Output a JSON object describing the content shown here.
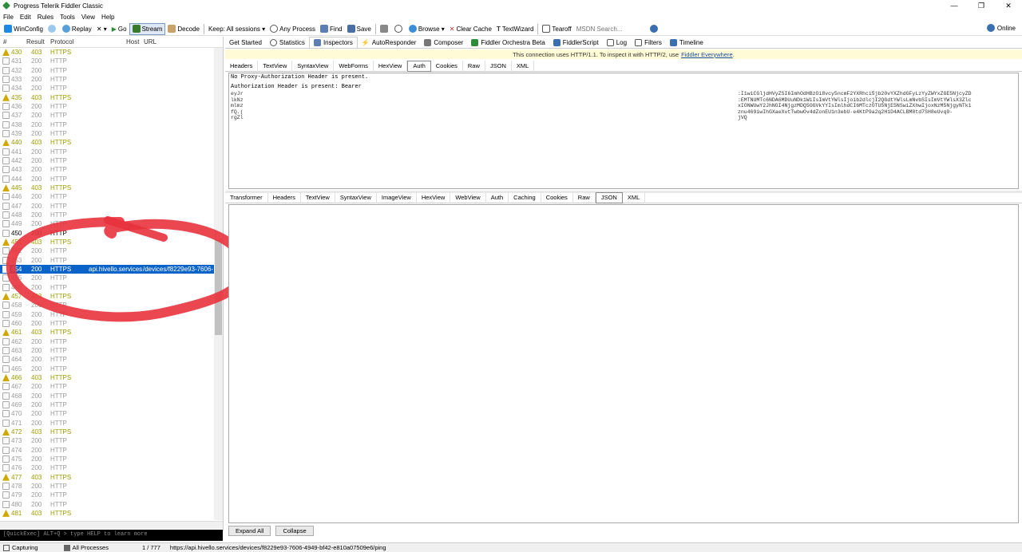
{
  "window": {
    "title": "Progress Telerik Fiddler Classic",
    "minimize": "—",
    "restore": "❐",
    "close": "✕"
  },
  "menu": [
    "File",
    "Edit",
    "Rules",
    "Tools",
    "View",
    "Help"
  ],
  "toolbar": {
    "winconfig": "WinConfig",
    "replay": "Replay",
    "remove": "✕ ▾",
    "go": "Go",
    "stream": "Stream",
    "decode": "Decode",
    "keep": "Keep: All sessions ▾",
    "any_process": "Any Process",
    "find": "Find",
    "save": "Save",
    "browse": "Browse ▾",
    "clear_cache": "Clear Cache",
    "textwizard": "TextWizard",
    "tearoff": "Tearoff",
    "search_placeholder": "MSDN Search...",
    "online": "Online"
  },
  "sessions": {
    "headers": {
      "num": "#",
      "result": "Result",
      "protocol": "Protocol",
      "host": "Host",
      "url": "URL"
    },
    "rows": [
      {
        "n": "430",
        "r": "403",
        "p": "HTTPS",
        "h": "",
        "u": "",
        "s": "olive",
        "i": "warn"
      },
      {
        "n": "431",
        "r": "200",
        "p": "HTTP",
        "h": "",
        "u": "",
        "s": "gray",
        "i": "doc"
      },
      {
        "n": "432",
        "r": "200",
        "p": "HTTP",
        "h": "",
        "u": "",
        "s": "gray",
        "i": "doc"
      },
      {
        "n": "433",
        "r": "200",
        "p": "HTTP",
        "h": "",
        "u": "",
        "s": "gray",
        "i": "doc"
      },
      {
        "n": "434",
        "r": "200",
        "p": "HTTP",
        "h": "",
        "u": "",
        "s": "gray",
        "i": "doc"
      },
      {
        "n": "435",
        "r": "403",
        "p": "HTTPS",
        "h": "",
        "u": "",
        "s": "olive",
        "i": "warn"
      },
      {
        "n": "436",
        "r": "200",
        "p": "HTTP",
        "h": "",
        "u": "",
        "s": "gray",
        "i": "doc"
      },
      {
        "n": "437",
        "r": "200",
        "p": "HTTP",
        "h": "",
        "u": "",
        "s": "gray",
        "i": "doc"
      },
      {
        "n": "438",
        "r": "200",
        "p": "HTTP",
        "h": "",
        "u": "",
        "s": "gray",
        "i": "doc"
      },
      {
        "n": "439",
        "r": "200",
        "p": "HTTP",
        "h": "",
        "u": "",
        "s": "gray",
        "i": "doc"
      },
      {
        "n": "440",
        "r": "403",
        "p": "HTTPS",
        "h": "",
        "u": "",
        "s": "olive",
        "i": "warn"
      },
      {
        "n": "441",
        "r": "200",
        "p": "HTTP",
        "h": "",
        "u": "",
        "s": "gray",
        "i": "doc"
      },
      {
        "n": "442",
        "r": "200",
        "p": "HTTP",
        "h": "",
        "u": "",
        "s": "gray",
        "i": "doc"
      },
      {
        "n": "443",
        "r": "200",
        "p": "HTTP",
        "h": "",
        "u": "",
        "s": "gray",
        "i": "doc"
      },
      {
        "n": "444",
        "r": "200",
        "p": "HTTP",
        "h": "",
        "u": "",
        "s": "gray",
        "i": "doc"
      },
      {
        "n": "445",
        "r": "403",
        "p": "HTTPS",
        "h": "",
        "u": "",
        "s": "olive",
        "i": "warn"
      },
      {
        "n": "446",
        "r": "200",
        "p": "HTTP",
        "h": "",
        "u": "",
        "s": "gray",
        "i": "doc"
      },
      {
        "n": "447",
        "r": "200",
        "p": "HTTP",
        "h": "",
        "u": "",
        "s": "gray",
        "i": "doc"
      },
      {
        "n": "448",
        "r": "200",
        "p": "HTTP",
        "h": "",
        "u": "",
        "s": "gray",
        "i": "doc"
      },
      {
        "n": "449",
        "r": "200",
        "p": "HTTP",
        "h": "",
        "u": "",
        "s": "gray",
        "i": "doc"
      },
      {
        "n": "450",
        "r": "200",
        "p": "HTTP",
        "h": "",
        "u": "",
        "s": "black",
        "i": "doc"
      },
      {
        "n": "451",
        "r": "403",
        "p": "HTTPS",
        "h": "",
        "u": "",
        "s": "olive",
        "i": "warn"
      },
      {
        "n": "452",
        "r": "200",
        "p": "HTTP",
        "h": "",
        "u": "",
        "s": "gray",
        "i": "doc"
      },
      {
        "n": "453",
        "r": "200",
        "p": "HTTP",
        "h": "",
        "u": "",
        "s": "gray",
        "i": "doc"
      },
      {
        "n": "454",
        "r": "200",
        "p": "HTTPS",
        "h": "api.hivello.services",
        "u": "/devices/f8229e93-7606-",
        "s": "sel",
        "i": "sel"
      },
      {
        "n": "455",
        "r": "200",
        "p": "HTTP",
        "h": "",
        "u": "",
        "s": "gray",
        "i": "doc"
      },
      {
        "n": "456",
        "r": "200",
        "p": "HTTP",
        "h": "",
        "u": "",
        "s": "gray",
        "i": "doc"
      },
      {
        "n": "457",
        "r": "403",
        "p": "HTTPS",
        "h": "",
        "u": "",
        "s": "olive",
        "i": "warn"
      },
      {
        "n": "458",
        "r": "200",
        "p": "HTTP",
        "h": "",
        "u": "",
        "s": "gray",
        "i": "doc"
      },
      {
        "n": "459",
        "r": "200",
        "p": "HTTP",
        "h": "",
        "u": "",
        "s": "gray",
        "i": "doc"
      },
      {
        "n": "460",
        "r": "200",
        "p": "HTTP",
        "h": "",
        "u": "",
        "s": "gray",
        "i": "doc"
      },
      {
        "n": "461",
        "r": "403",
        "p": "HTTPS",
        "h": "",
        "u": "",
        "s": "olive",
        "i": "warn"
      },
      {
        "n": "462",
        "r": "200",
        "p": "HTTP",
        "h": "",
        "u": "",
        "s": "gray",
        "i": "doc"
      },
      {
        "n": "463",
        "r": "200",
        "p": "HTTP",
        "h": "",
        "u": "",
        "s": "gray",
        "i": "doc"
      },
      {
        "n": "464",
        "r": "200",
        "p": "HTTP",
        "h": "",
        "u": "",
        "s": "gray",
        "i": "doc"
      },
      {
        "n": "465",
        "r": "200",
        "p": "HTTP",
        "h": "",
        "u": "",
        "s": "gray",
        "i": "doc"
      },
      {
        "n": "466",
        "r": "403",
        "p": "HTTPS",
        "h": "",
        "u": "",
        "s": "olive",
        "i": "warn"
      },
      {
        "n": "467",
        "r": "200",
        "p": "HTTP",
        "h": "",
        "u": "",
        "s": "gray",
        "i": "doc"
      },
      {
        "n": "468",
        "r": "200",
        "p": "HTTP",
        "h": "",
        "u": "",
        "s": "gray",
        "i": "doc"
      },
      {
        "n": "469",
        "r": "200",
        "p": "HTTP",
        "h": "",
        "u": "",
        "s": "gray",
        "i": "doc"
      },
      {
        "n": "470",
        "r": "200",
        "p": "HTTP",
        "h": "",
        "u": "",
        "s": "gray",
        "i": "doc"
      },
      {
        "n": "471",
        "r": "200",
        "p": "HTTP",
        "h": "",
        "u": "",
        "s": "gray",
        "i": "doc"
      },
      {
        "n": "472",
        "r": "403",
        "p": "HTTPS",
        "h": "",
        "u": "",
        "s": "olive",
        "i": "warn"
      },
      {
        "n": "473",
        "r": "200",
        "p": "HTTP",
        "h": "",
        "u": "",
        "s": "gray",
        "i": "doc"
      },
      {
        "n": "474",
        "r": "200",
        "p": "HTTP",
        "h": "",
        "u": "",
        "s": "gray",
        "i": "doc"
      },
      {
        "n": "475",
        "r": "200",
        "p": "HTTP",
        "h": "",
        "u": "",
        "s": "gray",
        "i": "doc"
      },
      {
        "n": "476",
        "r": "200",
        "p": "HTTP",
        "h": "",
        "u": "",
        "s": "gray",
        "i": "doc"
      },
      {
        "n": "477",
        "r": "403",
        "p": "HTTPS",
        "h": "",
        "u": "",
        "s": "olive",
        "i": "warn"
      },
      {
        "n": "478",
        "r": "200",
        "p": "HTTP",
        "h": "",
        "u": "",
        "s": "gray",
        "i": "doc"
      },
      {
        "n": "479",
        "r": "200",
        "p": "HTTP",
        "h": "",
        "u": "",
        "s": "gray",
        "i": "doc"
      },
      {
        "n": "480",
        "r": "200",
        "p": "HTTP",
        "h": "",
        "u": "",
        "s": "gray",
        "i": "doc"
      },
      {
        "n": "481",
        "r": "403",
        "p": "HTTPS",
        "h": "",
        "u": "",
        "s": "olive",
        "i": "warn"
      }
    ]
  },
  "quickexec": "[QuickExec] ALT+Q > type HELP to learn more",
  "main_tabs": [
    "Get Started",
    "Statistics",
    "Inspectors",
    "AutoResponder",
    "Composer",
    "Fiddler Orchestra Beta",
    "FiddlerScript",
    "Log",
    "Filters",
    "Timeline"
  ],
  "infobar": {
    "text": "This connection uses HTTP/1.1. To inspect it with HTTP/2, use",
    "link": "Fiddler Everywhere",
    "end": "."
  },
  "request_tabs": [
    "Headers",
    "TextView",
    "SyntaxView",
    "WebForms",
    "HexView",
    "Auth",
    "Cookies",
    "Raw",
    "JSON",
    "XML"
  ],
  "request_active": "Auth",
  "auth": {
    "line1": "No Proxy-Authorization Header is present.",
    "line2": "Authorization Header is present: Bearer",
    "left": [
      "eyJr",
      "lkNz",
      "mlmz",
      "fQ.(",
      "rgZl"
    ],
    "right": [
      ":I1wiCGljdHVyZSI6ImhOdHBzOi8vcy5ncmF2YXRhci5jb20vYXZhdGFyLzYyZWYxZGE5NjcyZD",
      ":EMTNUMTc6NDA6MDUuNDk1WiIsImVtYWlsIjoib2dlcjI2QGdtYWlsLmNvbSIsImVtYWlsX3Zlc",
      "xIONWUwY2JhNGI4NjgzMDQ5OGVkYYIsImlhdCI6MTczOTU5NjE5NSwiZXhwIjoxNzM5NjgyNTk1",
      "znu469iwIhGXaeXvtTwbwOv4dZonEU1n3ebU-e4KtP9a2q2H1D4ACLBM8td7SH8eUvq9-",
      "jVQ"
    ]
  },
  "response_tabs": [
    "Transformer",
    "Headers",
    "TextView",
    "SyntaxView",
    "ImageView",
    "HexView",
    "WebView",
    "Auth",
    "Caching",
    "Cookies",
    "Raw",
    "JSON",
    "XML"
  ],
  "response_active": "JSON",
  "footer": {
    "expand": "Expand All",
    "collapse": "Collapse"
  },
  "status": {
    "capturing": "Capturing",
    "processes": "All Processes",
    "count": "1 / 777",
    "url": "https://api.hivello.services/devices/f8229e93-7606-4949-bf42-e810a07509e6/ping"
  },
  "colors": {
    "selection": "#0a63c9",
    "annotation": "#e8333d",
    "info_bg": "#fffbd6",
    "warn_text": "#9c9c00"
  }
}
